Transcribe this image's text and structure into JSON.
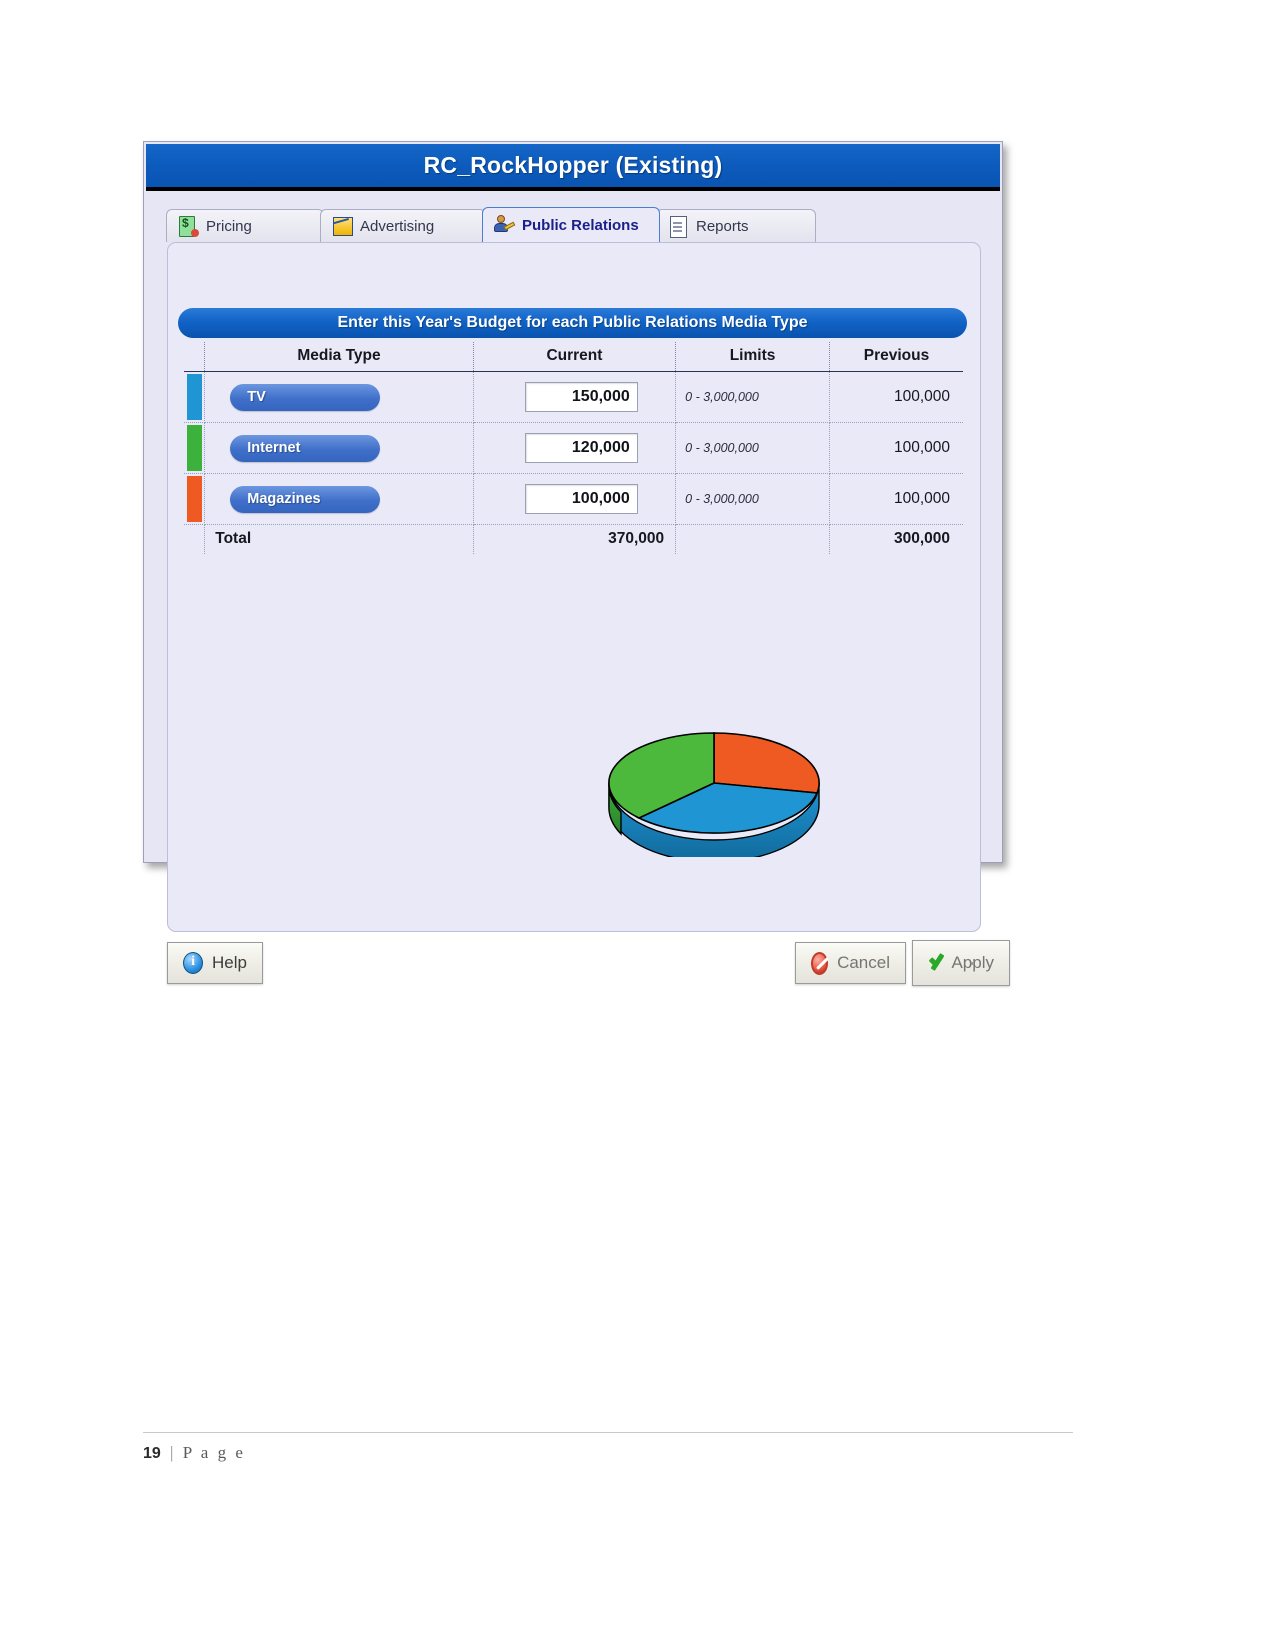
{
  "window": {
    "title": "RC_RockHopper (Existing)"
  },
  "tabs": [
    {
      "label": "Pricing",
      "icon": "price-tag-icon",
      "active": false
    },
    {
      "label": "Advertising",
      "icon": "chart-icon",
      "active": false
    },
    {
      "label": "Public Relations",
      "icon": "person-icon",
      "active": true
    },
    {
      "label": "Reports",
      "icon": "document-icon",
      "active": false
    }
  ],
  "banner": {
    "text": "Enter this Year's Budget for each Public Relations Media Type"
  },
  "table": {
    "headers": [
      "Media Type",
      "Current",
      "Limits",
      "Previous"
    ],
    "rows": [
      {
        "media": "TV",
        "current": "150,000",
        "limits": "0 - 3,000,000",
        "previous": "100,000",
        "color": "#1f95d4"
      },
      {
        "media": "Internet",
        "current": "120,000",
        "limits": "0 - 3,000,000",
        "previous": "100,000",
        "color": "#3cb23c"
      },
      {
        "media": "Magazines",
        "current": "100,000",
        "limits": "0 - 3,000,000",
        "previous": "100,000",
        "color": "#ef5a22"
      }
    ],
    "total": {
      "label": "Total",
      "current": "370,000",
      "limits": "",
      "previous": "300,000"
    }
  },
  "chart_data": {
    "type": "pie",
    "title": "",
    "categories": [
      "TV",
      "Internet",
      "Magazines"
    ],
    "values": [
      150000,
      120000,
      100000
    ],
    "percentages": [
      40.5,
      32.4,
      27.0
    ],
    "colors": [
      "#1f95d4",
      "#3cb23c",
      "#ef5a22"
    ],
    "legend": "none",
    "style": "3d-pie"
  },
  "buttons": {
    "help": {
      "label": "Help",
      "icon": "info-icon"
    },
    "cancel": {
      "label": "Cancel",
      "icon": "deny-icon"
    },
    "apply": {
      "label": "Apply",
      "icon": "check-icon"
    }
  },
  "page_footer": {
    "number": "19",
    "separator": "|",
    "text": "P a g e"
  },
  "colors": {
    "titlebar": "#0c5bbd",
    "banner": "#1062c6",
    "panel": "#e9e9f8",
    "pill": "#3f6fc9"
  }
}
